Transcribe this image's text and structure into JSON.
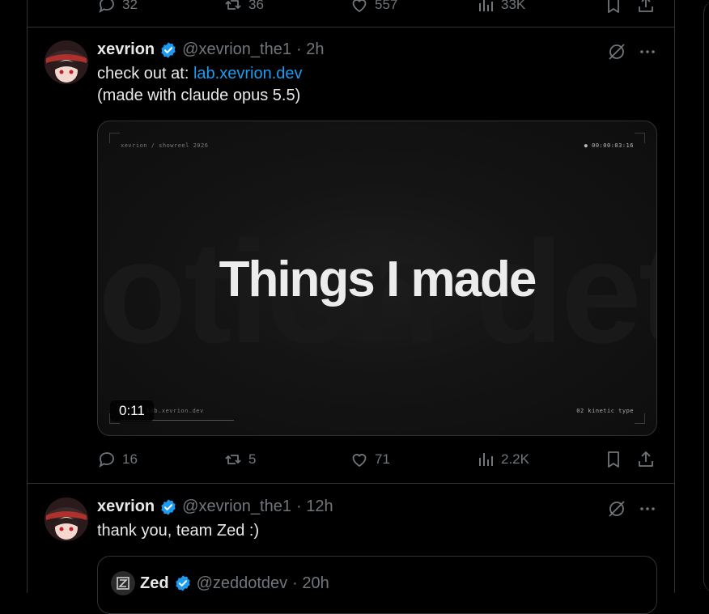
{
  "top_actions": {
    "replies": "32",
    "reposts": "36",
    "likes": "557",
    "views": "33K"
  },
  "post1": {
    "author": "xevrion",
    "handle": "@xevrion_the1",
    "time": "· 2h",
    "text_prefix": "check out at: ",
    "link": "lab.xevrion.dev",
    "line2": "(made with claude opus 5.5)",
    "media": {
      "top_left": "xevrion / showreel 2026",
      "top_right": "● 00:00:03:16",
      "bg_word": "otion det",
      "headline": "Things I made",
      "bottom_left": "lab.xevrion.dev",
      "bottom_right": "02  kinetic type",
      "duration": "0:11"
    },
    "actions": {
      "replies": "16",
      "reposts": "5",
      "likes": "71",
      "views": "2.2K"
    }
  },
  "post2": {
    "author": "xevrion",
    "handle": "@xevrion_the1",
    "time": "· 12h",
    "text": "thank you, team Zed :)",
    "quote": {
      "author": "Zed",
      "handle": "@zeddotdev",
      "time": "· 20h"
    }
  },
  "colors": {
    "background": "#000000",
    "text": "#e7e9ea",
    "muted": "#71767b",
    "link": "#1d9bf0",
    "verified": "#1d9bf0",
    "border": "#2f3336"
  }
}
